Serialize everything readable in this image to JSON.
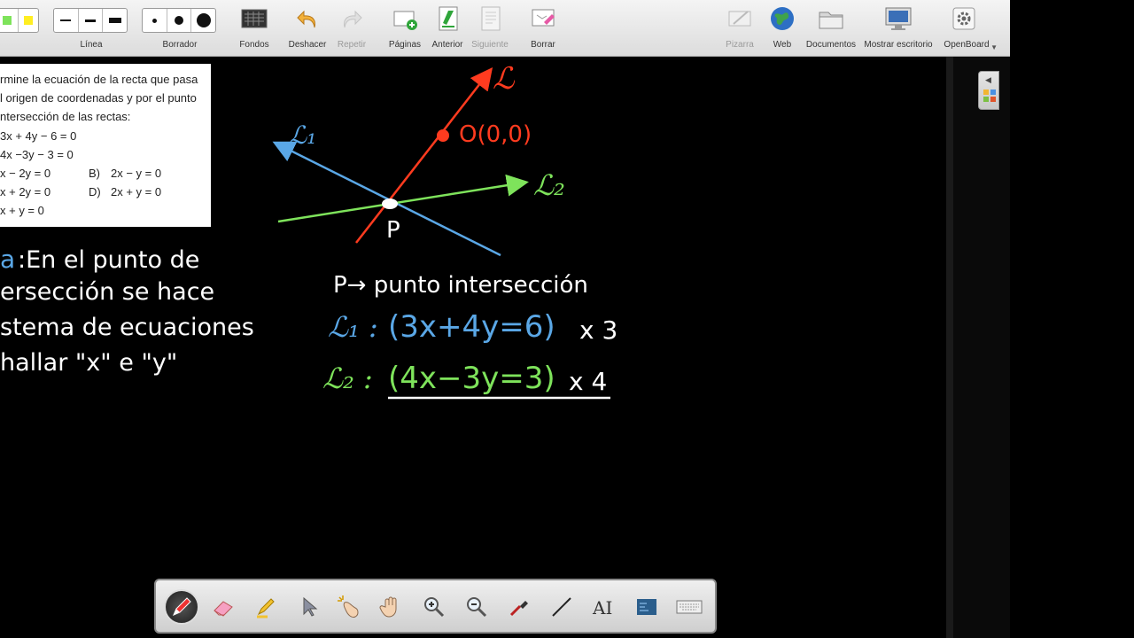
{
  "toolbar": {
    "line_label": "Línea",
    "eraser_label": "Borrador",
    "backgrounds_label": "Fondos",
    "undo_label": "Deshacer",
    "redo_label": "Repetir",
    "pages_label": "Páginas",
    "previous_label": "Anterior",
    "next_label": "Siguiente",
    "clear_label": "Borrar",
    "board_label": "Pizarra",
    "web_label": "Web",
    "documents_label": "Documentos",
    "desktop_label": "Mostrar escritorio",
    "app_label": "OpenBoard"
  },
  "question": {
    "lines": [
      "rmine la ecuación de la recta que pasa",
      "l origen de coordenadas y por el punto",
      "ntersección de las rectas:",
      "3x + 4y − 6 = 0",
      "4x −3y − 3 = 0"
    ],
    "options": [
      {
        "left": "x − 2y = 0",
        "right_letter": "B)",
        "right": "2x − y = 0"
      },
      {
        "left": "x + 2y = 0",
        "right_letter": "D)",
        "right": "2x + y = 0"
      },
      {
        "left": "x + y = 0",
        "right_letter": "",
        "right": ""
      }
    ]
  },
  "handwriting": {
    "left_lines": [
      ":En el punto de",
      "ersección se hace",
      "stema de ecuaciones",
      "hallar \"x\" e \"y\""
    ],
    "label_L": "ℒ",
    "label_L1": "ℒ₁",
    "label_L2": "ℒ₂",
    "origin_label": "O(0,0)",
    "point_label": "P",
    "intersection_note": "P→ punto intersección",
    "eq1_prefix": "ℒ₁ :",
    "eq1_body": "(3x+4y=6)",
    "eq1_mult": "x 3",
    "eq2_prefix": "ℒ₂ :",
    "eq2_body": "(4x−3y=3)",
    "eq2_mult": "x 4"
  },
  "colors": {
    "red": "#ff3b1f",
    "blue": "#5aa7e6",
    "green": "#7ee35b",
    "white": "#ffffff"
  },
  "bottom_tools": [
    "pen-icon",
    "eraser-icon",
    "highlighter-icon",
    "pointer-icon",
    "laser-icon",
    "hand-icon",
    "zoom-in-icon",
    "zoom-out-icon",
    "capture-icon",
    "line-tool-icon",
    "text-icon",
    "screenshot-icon",
    "keyboard-icon"
  ]
}
